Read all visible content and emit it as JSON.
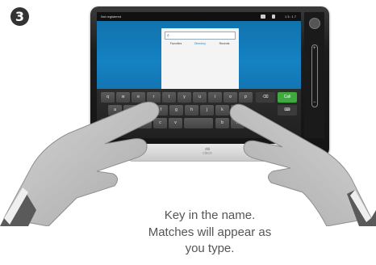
{
  "step": {
    "number": "3"
  },
  "device": {
    "status": {
      "left_text": "Not registered",
      "right_text": "13:17"
    },
    "search": {
      "placeholder": "",
      "tabs": [
        {
          "label": "Favorites",
          "active": false
        },
        {
          "label": "Directory",
          "active": true
        },
        {
          "label": "Recents",
          "active": false
        }
      ],
      "empty_message": "No directory"
    },
    "keyboard": {
      "rows": [
        [
          "q",
          "w",
          "e",
          "r",
          "t",
          "y",
          "u",
          "i",
          "o",
          "p"
        ],
        [
          "a",
          "s",
          "d",
          "f",
          "g",
          "h",
          "j",
          "k",
          "l"
        ],
        [
          "z",
          "x",
          "c",
          "v",
          "b",
          "n",
          "m"
        ]
      ],
      "call_label": "Call"
    },
    "brand": "cisco",
    "volume": {
      "plus_label": "+",
      "minus_label": "−"
    }
  },
  "caption": {
    "line1": "Key in the name.",
    "line2": "Matches will appear as",
    "line3": "you type."
  },
  "colors": {
    "screen_blue": "#1582c2",
    "call_green": "#3eaa3e",
    "caption_text": "#555555"
  }
}
